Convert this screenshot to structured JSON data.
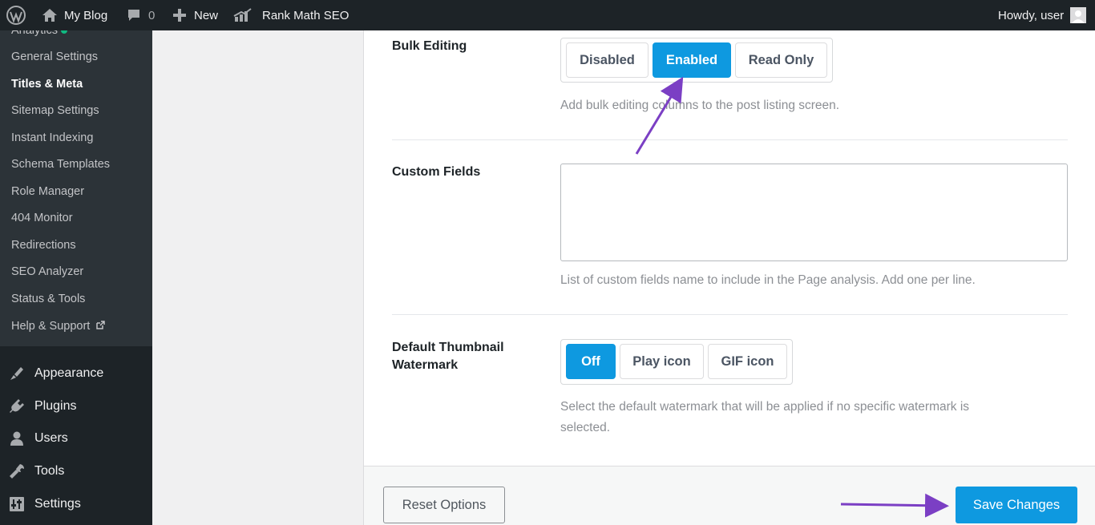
{
  "adminbar": {
    "site_name": "My Blog",
    "comments_count": "0",
    "new_label": "New",
    "rank_math_label": "Rank Math SEO",
    "howdy": "Howdy, user"
  },
  "sidebar": {
    "submenu": [
      {
        "label": "Analytics",
        "badge": true
      },
      {
        "label": "General Settings"
      },
      {
        "label": "Titles & Meta",
        "current": true
      },
      {
        "label": "Sitemap Settings"
      },
      {
        "label": "Instant Indexing"
      },
      {
        "label": "Schema Templates"
      },
      {
        "label": "Role Manager"
      },
      {
        "label": "404 Monitor"
      },
      {
        "label": "Redirections"
      },
      {
        "label": "SEO Analyzer"
      },
      {
        "label": "Status & Tools"
      },
      {
        "label": "Help & Support"
      }
    ],
    "menu": [
      {
        "label": "Appearance",
        "icon": "paintbrush-icon"
      },
      {
        "label": "Plugins",
        "icon": "plugin-icon"
      },
      {
        "label": "Users",
        "icon": "users-icon"
      },
      {
        "label": "Tools",
        "icon": "wrench-icon"
      },
      {
        "label": "Settings",
        "icon": "settings-sliders-icon"
      }
    ]
  },
  "settings": {
    "bulk_editing": {
      "label": "Bulk Editing",
      "options": [
        "Disabled",
        "Enabled",
        "Read Only"
      ],
      "selected": "Enabled",
      "description": "Add bulk editing columns to the post listing screen."
    },
    "custom_fields": {
      "label": "Custom Fields",
      "value": "",
      "description": "List of custom fields name to include in the Page analysis. Add one per line."
    },
    "thumbnail_watermark": {
      "label_line1": "Default Thumbnail",
      "label_line2": "Watermark",
      "options": [
        "Off",
        "Play icon",
        "GIF icon"
      ],
      "selected": "Off",
      "description_line1": "Select the default watermark that will be applied if no specific watermark is",
      "description_line2": "selected."
    }
  },
  "footer": {
    "reset_label": "Reset Options",
    "save_label": "Save Changes"
  },
  "colors": {
    "accent": "#0e99e0",
    "admin_bar": "#1d2327",
    "annotation_arrow": "#7b3fc4"
  }
}
